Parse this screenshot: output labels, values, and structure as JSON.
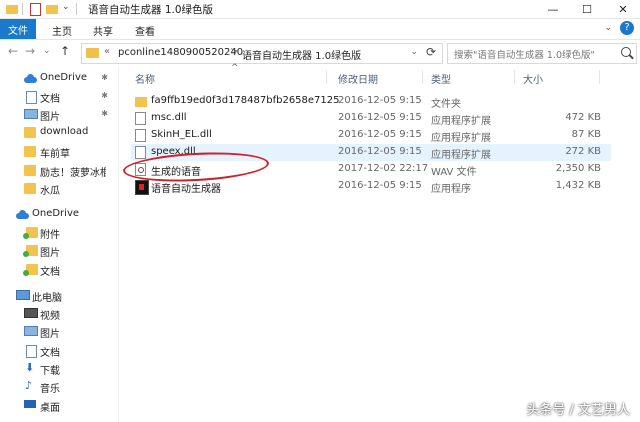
{
  "window": {
    "title": "语音自动生成器 1.0绿色版",
    "controls": {
      "minimize": "—",
      "maximize": "☐",
      "close": "✕"
    }
  },
  "ribbon": {
    "tabs": [
      "文件",
      "主页",
      "共享",
      "查看"
    ],
    "expand": "⌄",
    "help": "?"
  },
  "nav": {
    "back": "←",
    "forward": "→",
    "recent": "⌄",
    "up": "↑",
    "breadcrumb_prefix": "«",
    "path": [
      "pconline1480900520240",
      "语音自动生成器 1.0绿色版"
    ],
    "separator": ">",
    "dropdown": "⌄",
    "refresh": "⟳",
    "search_placeholder": "搜索\"语音自动生成器 1.0绿色版\""
  },
  "sidebar": {
    "items": [
      {
        "label": "OneDrive",
        "icon": "cloud-icon",
        "pinned": true
      },
      {
        "label": "文档",
        "icon": "document-icon",
        "pinned": true
      },
      {
        "label": "图片",
        "icon": "picture-icon",
        "pinned": true
      },
      {
        "label": "download",
        "icon": "folder-icon",
        "pinned": false
      },
      {
        "label": "车前草",
        "icon": "folder-icon",
        "pinned": false
      },
      {
        "label": "励志！菠萝冰棍",
        "icon": "folder-icon",
        "pinned": false
      },
      {
        "label": "水瓜",
        "icon": "folder-icon",
        "pinned": false
      },
      {
        "label": "OneDrive",
        "icon": "cloud-icon",
        "pinned": false
      },
      {
        "label": "附件",
        "icon": "folder-sync-icon",
        "pinned": false
      },
      {
        "label": "图片",
        "icon": "folder-sync-icon",
        "pinned": false
      },
      {
        "label": "文档",
        "icon": "folder-sync-icon",
        "pinned": false
      },
      {
        "label": "此电脑",
        "icon": "computer-icon",
        "pinned": false
      },
      {
        "label": "视频",
        "icon": "video-icon",
        "pinned": false
      },
      {
        "label": "图片",
        "icon": "picture-icon",
        "pinned": false
      },
      {
        "label": "文档",
        "icon": "document-icon",
        "pinned": false
      },
      {
        "label": "下载",
        "icon": "download-icon",
        "pinned": false
      },
      {
        "label": "音乐",
        "icon": "music-icon",
        "pinned": false
      },
      {
        "label": "桌面",
        "icon": "desktop-icon",
        "pinned": false
      }
    ],
    "pin_glyph": "📌"
  },
  "columns": {
    "sort_indicator": "^",
    "name": "名称",
    "modified": "修改日期",
    "type": "类型",
    "size": "大小"
  },
  "files": [
    {
      "name": "fa9ffb19ed0f3d178487bfb2658e7125",
      "modified": "2016-12-05 9:15",
      "type": "文件夹",
      "size": "",
      "icon": "folder-icon"
    },
    {
      "name": "msc.dll",
      "modified": "2016-12-05 9:15",
      "type": "应用程序扩展",
      "size": "472 KB",
      "icon": "dll-file-icon"
    },
    {
      "name": "SkinH_EL.dll",
      "modified": "2016-12-05 9:15",
      "type": "应用程序扩展",
      "size": "87 KB",
      "icon": "dll-file-icon"
    },
    {
      "name": "speex.dll",
      "modified": "2016-12-05 9:15",
      "type": "应用程序扩展",
      "size": "272 KB",
      "icon": "dll-file-icon"
    },
    {
      "name": "生成的语音",
      "modified": "2017-12-02 22:17",
      "type": "WAV 文件",
      "size": "2,350 KB",
      "icon": "wav-file-icon"
    },
    {
      "name": "语音自动生成器",
      "modified": "2016-12-05 9:15",
      "type": "应用程序",
      "size": "1,432 KB",
      "icon": "app-icon"
    }
  ],
  "colors": {
    "accent": "#1979ca",
    "annotation": "#d01f26",
    "selected_row": "#e5f3ff"
  },
  "watermark": "头条号 / 文艺男人"
}
